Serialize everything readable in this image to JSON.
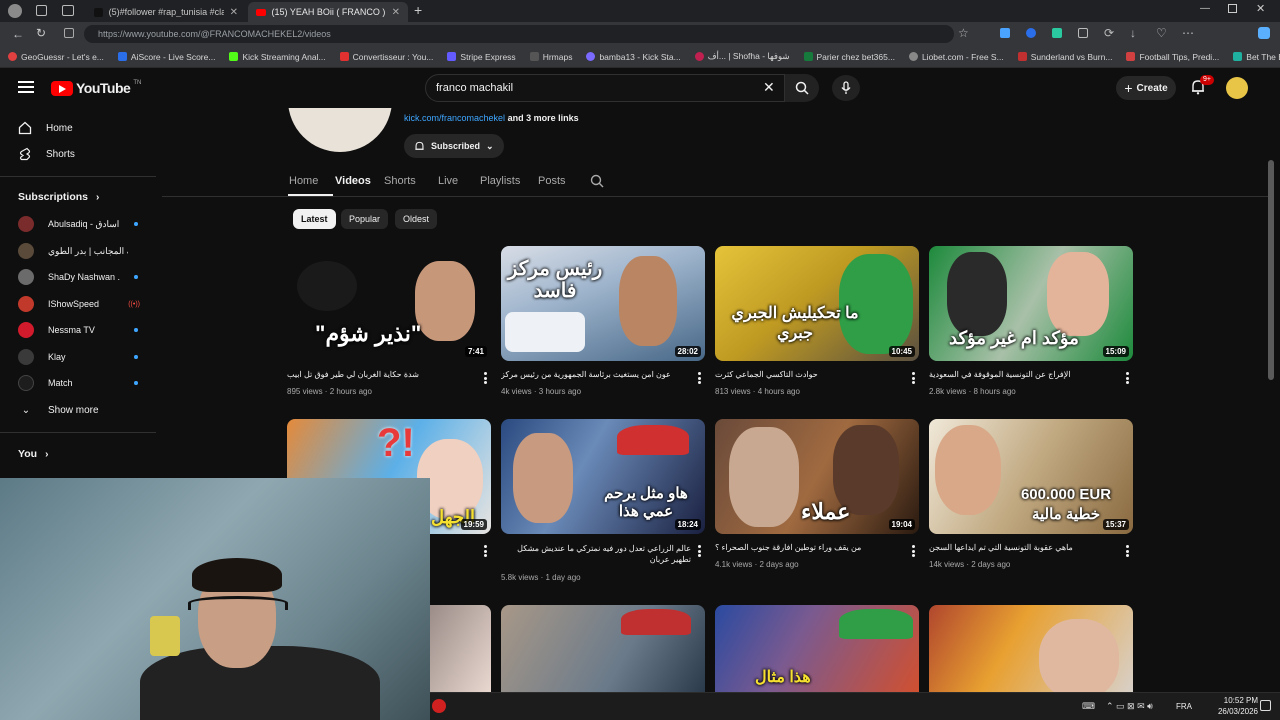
{
  "browser": {
    "tabs": [
      {
        "label": "(5)#follower #rap_tunisia #clach..."
      },
      {
        "label": "(15) YEAH BOii ( FRANCO ) - You..."
      }
    ],
    "url": "https://www.youtube.com/@FRANCOMACHEKEL2/videos",
    "bookmarks": [
      "GeoGuessr - Let's e...",
      "AiScore - Live Score...",
      "Kick Streaming Anal...",
      "Convertisseur : You...",
      "Stripe Express",
      "Hrmaps",
      "bamba13 - Kick Sta...",
      "أف... | Shofha - شوفها",
      "Parier chez bet365...",
      "Liobet.com - Free S...",
      "Sunderland vs Burn...",
      "Football Tips, Predi...",
      "Bet The Builder"
    ]
  },
  "header": {
    "logo": "YouTube",
    "logo_sup": "TN",
    "search_value": "franco machakil",
    "create_label": "Create",
    "notif_count": "9+"
  },
  "sidebar": {
    "home": "Home",
    "shorts": "Shorts",
    "subscriptions_title": "Subscriptions",
    "subscriptions": [
      {
        "name": "Abulsadiq - اسادق...",
        "color": "#7a2b2b"
      },
      {
        "name": "قرية المجانب | بدر الطوي",
        "color": "#5a4a3a"
      },
      {
        "name": "ShaDy Nashwan ...",
        "color": "#6b6b6b"
      },
      {
        "name": "IShowSpeed",
        "color": "#c0392b"
      },
      {
        "name": "Nessma TV",
        "color": "#d11b2c"
      },
      {
        "name": "Klay",
        "color": "#3a3a3a"
      },
      {
        "name": "Match",
        "color": "#1d1d1d"
      }
    ],
    "show_more": "Show more",
    "you_title": "You"
  },
  "channel": {
    "link": "kick.com/francomachekel",
    "more_links": "and 3 more links",
    "subscribed": "Subscribed",
    "tabs": [
      "Home",
      "Videos",
      "Shorts",
      "Live",
      "Playlists",
      "Posts"
    ],
    "active_tab": "Videos",
    "chips": [
      "Latest",
      "Popular",
      "Oldest"
    ]
  },
  "videos": [
    {
      "overlay": "\"نذير شؤم\"",
      "duration": "7:41",
      "title": "شدة حكاية الغربان لي طير فوق تل ابيب",
      "views": "895 views",
      "age": "2 hours ago",
      "bg": "#5b5d60"
    },
    {
      "overlay": "رئيس مركز فاسد",
      "duration": "28:02",
      "title": "عون امن يستغيث برئاسة الجمهورية من رئيس مركز",
      "views": "4k views",
      "age": "3 hours ago",
      "bg": "#4a6b8e"
    },
    {
      "overlay": "ما تحكيليش الجبري جبري",
      "duration": "10:45",
      "title": "حوادث التاكسي الجماعي كثرت",
      "views": "813 views",
      "age": "4 hours ago",
      "bg": "#b8962a"
    },
    {
      "overlay": "مؤكد ام غير مؤكد",
      "duration": "15:09",
      "title": "الإفراج عن التونسية الموقوفة في السعودية",
      "views": "2.8k views",
      "age": "8 hours ago",
      "bg": "#1f7a3c"
    },
    {
      "overlay": "الجهل",
      "duration": "19:59",
      "title": "",
      "views": "",
      "age": "",
      "bg": "#c94a4a"
    },
    {
      "overlay": "هاو مثل يرحم عمي هذا",
      "duration": "18:24",
      "title": "عالم الزراعي تعدل دور فيه نمتركي ما عنديش مشكل تطهير عربان",
      "views": "5.8k views",
      "age": "1 day ago",
      "bg": "#3d5680"
    },
    {
      "overlay": "عملاء",
      "duration": "19:04",
      "title": "من يقف وراء توطين افارقة جنوب الصحراء ؟",
      "views": "4.1k views",
      "age": "2 days ago",
      "bg": "#7a4a2a"
    },
    {
      "overlay": "600.000 EUR خطية مالية",
      "duration": "15:37",
      "title": "ماهي عقوبة التونسية التي تم ايداعها السجن",
      "views": "14k views",
      "age": "2 days ago",
      "bg": "#8a7a5a"
    },
    {
      "overlay": "",
      "duration": "",
      "title": "",
      "views": "",
      "age": "",
      "bg": "#3a3030"
    },
    {
      "overlay": "",
      "duration": "",
      "title": "",
      "views": "",
      "age": "",
      "bg": "#6a6a6a"
    },
    {
      "overlay": "هذا مثال",
      "duration": "",
      "title": "",
      "views": "",
      "age": "",
      "bg": "#2a4aa0"
    },
    {
      "overlay": "",
      "duration": "",
      "title": "",
      "views": "",
      "age": "",
      "bg": "#b0462e"
    }
  ],
  "taskbar": {
    "lang": "FRA",
    "time": "10:52 PM",
    "date": "26/03/2026"
  }
}
